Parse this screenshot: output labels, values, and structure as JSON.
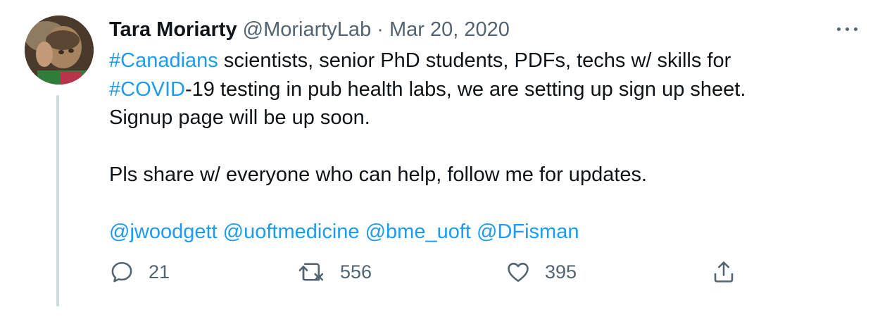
{
  "tweet": {
    "author": {
      "name": "Tara Moriarty",
      "handle": "@MoriartyLab",
      "separator": "·",
      "date": "Mar 20, 2020",
      "avatar_icon": "profile-photo"
    },
    "more_icon": "more-horizontal-icon",
    "text": {
      "line1_hashtag": "#Canadians",
      "line1_rest": " scientists, senior PhD students, PDFs, techs w/ skills for",
      "line2_hashtag": "#COVID",
      "line2_rest": "-19 testing in pub health labs, we are setting up sign up sheet.",
      "line3": "Signup page will be up soon.",
      "line4": "Pls share w/ everyone who can help, follow me for updates.",
      "mentions": [
        "@jwoodgett",
        "@uoftmedicine",
        "@bme_uoft",
        "@DFisman"
      ]
    },
    "actions": {
      "reply": {
        "icon": "reply-icon",
        "count": "21"
      },
      "retweet": {
        "icon": "retweet-icon",
        "count": "556"
      },
      "like": {
        "icon": "heart-icon",
        "count": "395"
      },
      "share": {
        "icon": "share-icon"
      }
    },
    "colors": {
      "link": "#1d9bf0",
      "text": "#0f1419",
      "secondary": "#536471",
      "thread_line": "#cfd9de"
    }
  }
}
